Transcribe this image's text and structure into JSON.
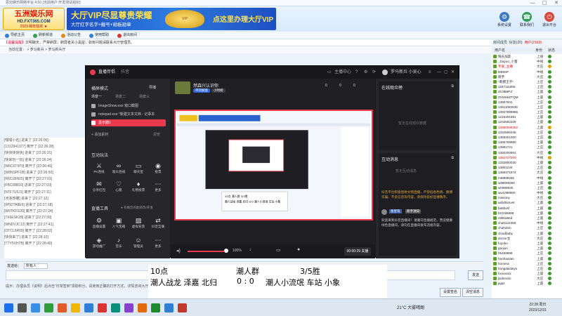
{
  "window": {
    "title": "思迈娱乐网络平台 4.50 [当前用户:开发测试组织]",
    "min": "—",
    "max": "▢",
    "close": "✕"
  },
  "banner": {
    "logo_main": "五洲娱乐网",
    "logo_url": "HD.FXT365.COM",
    "logo_sub": "2023 跨年狂欢 ★",
    "vip_title": "大厅VIP尽显尊贵荣耀",
    "vip_sub": "大厅红字名字+靓号+勋板勋章",
    "vip_crest": "VIP",
    "vip_cta": "点这里办理大厅VIP",
    "right_icons": [
      {
        "label": "系统设置",
        "color": "#3b78c5",
        "glyph": "⚙"
      },
      {
        "label": "联系我们",
        "color": "#2d9d58",
        "glyph": "☎"
      },
      {
        "label": "退出平台",
        "color": "#d9473d",
        "glyph": "⏻"
      }
    ]
  },
  "toolbar": [
    {
      "label": "导航主页",
      "color": "#2f7fd6"
    },
    {
      "label": "刷新频道",
      "color": "#30a04a"
    },
    {
      "label": "活动公告",
      "color": "#e08b16"
    },
    {
      "label": "使用帮助",
      "color": "#2f7fd6"
    },
    {
      "label": "退出房间",
      "color": "#d33"
    }
  ],
  "announce": {
    "tag": "【温馨提醒】",
    "text": "文明聊天，严禁刷屏，刷屏者关小黑屋，如有问题请联系大厅管理员。"
  },
  "roomnav": "当前位置：  >  罗马新兵  >  罗马新兵厅",
  "chat_messages": [
    "[嘿嘿小名] 进来了 [22:26:00]",
    "[1312941377] 离开了 [22:26:28]",
    "[快快快快快] 进来了 [22:26:31]",
    "[快来玩一玩] 进来了 [22:26:34]",
    "[W6C6T9T9] 离开了 [22:26:46]",
    "[W8NSPF1B] 进来了 [22:26:50]",
    "[R6C1BN15] 离开了 [22:27:01]",
    "[FBC08B16] 进来了 [22:27:03]",
    "[NTF7U5J1] 离开了 [22:27:11]",
    "[河洛传雕] 进来了 [22:27:12]",
    "[W5DTA8E6] 进来了 [22:27:18]",
    "[W9TKFG39] 离开了 [22:27:24]",
    "[7X6ESK28] 进来了 [22:27:30]",
    "[WNDVJC12] 离开了 [22:27:41]",
    "[OTCL5R09] 离开了 [22:28:02]",
    "[快快来了] 进来了 [22:28:10]",
    "[TTY5VH7B] 离开了 [22:28:40]"
  ],
  "chat_input": {
    "to_label": "发送给：",
    "target": "所有人",
    "send": "发送"
  },
  "hint": "提示：办理会员《说明》后点击“日常签到”领取积分，请使用正确的打开方式，详情咨询大厅客服。",
  "bottom_buttons": [
    "设置签名",
    "清空消息"
  ],
  "user_tabs": [
    "房间成员",
    "好友(20)",
    "用户(2163)"
  ],
  "user_head": [
    "用户名",
    "身份",
    "状态"
  ],
  "users": [
    {
      "name": "快乐加友",
      "role": "上线",
      "vip": false,
      "badge": "g"
    },
    {
      "name": "_Dayoo_小蜜",
      "role": "中线",
      "vip": false,
      "badge": "g"
    },
    {
      "name": "专爱_主播",
      "role": "大庄",
      "vip": true,
      "badge": "o"
    },
    {
      "name": "DB9SP",
      "role": "中线",
      "vip": false,
      "badge": "g"
    },
    {
      "name": "晓宇",
      "role": "大庄",
      "vip": false,
      "badge": "g"
    },
    {
      "name": "*刺猬王子*",
      "role": "上庄",
      "vip": false,
      "badge": "g"
    },
    {
      "name": "1167111655",
      "role": "上庄",
      "vip": false,
      "badge": "g"
    },
    {
      "name": "ZC9B8PZ",
      "role": "上座",
      "vip": false,
      "badge": "g"
    },
    {
      "name": "ZXMH8ZTQM",
      "role": "上座",
      "vip": false,
      "badge": "g"
    },
    {
      "name": "13857931",
      "role": "上庄",
      "vip": false,
      "badge": "g"
    },
    {
      "name": "13611083539",
      "role": "上庄",
      "vip": false,
      "badge": "g"
    },
    {
      "name": "13927999985",
      "role": "上庄",
      "vip": false,
      "badge": "g"
    },
    {
      "name": "1216191981",
      "role": "上座",
      "vip": false,
      "badge": "g"
    },
    {
      "name": "1233592329",
      "role": "上座",
      "vip": false,
      "badge": "g"
    },
    {
      "name": "13980098352",
      "role": "上座",
      "vip": true,
      "badge": "o"
    },
    {
      "name": "1334596345",
      "role": "上庄",
      "vip": false,
      "badge": "g"
    },
    {
      "name": "1368201000",
      "role": "上庄",
      "vip": false,
      "badge": "g"
    },
    {
      "name": "1365768980",
      "role": "上座",
      "vip": false,
      "badge": "g"
    },
    {
      "name": "13981721",
      "role": "上庄",
      "vip": false,
      "badge": "g"
    },
    {
      "name": "1360200901",
      "role": "大庄",
      "vip": false,
      "badge": "g"
    },
    {
      "name": "1392727000",
      "role": "中线",
      "vip": true,
      "badge": "o"
    },
    {
      "name": "1332800030",
      "role": "上座",
      "vip": false,
      "badge": "g"
    },
    {
      "name": "13801234",
      "role": "上庄",
      "vip": false,
      "badge": "g"
    },
    {
      "name": "1369371974",
      "role": "大庄",
      "vip": false,
      "badge": "g"
    },
    {
      "name": "mt8899282",
      "role": "中线",
      "vip": false,
      "badge": "g"
    },
    {
      "name": "w88099250",
      "role": "上座",
      "vip": false,
      "badge": "g"
    },
    {
      "name": "wh999820",
      "role": "上庄",
      "vip": false,
      "badge": "g"
    },
    {
      "name": "ww1098900",
      "role": "中线",
      "vip": false,
      "badge": "g"
    },
    {
      "name": "missony",
      "role": "大庄",
      "vip": false,
      "badge": "g"
    },
    {
      "name": "asbdtsmvet",
      "role": "上座",
      "vip": false,
      "badge": "g"
    },
    {
      "name": "ba5bvsf",
      "role": "上座",
      "vip": false,
      "badge": "g"
    },
    {
      "name": "bzzz66888",
      "role": "上座",
      "vip": false,
      "badge": "g"
    },
    {
      "name": "c980a9ed",
      "role": "上座",
      "vip": false,
      "badge": "g"
    },
    {
      "name": "chatt122466",
      "role": "中线",
      "vip": false,
      "badge": "g"
    },
    {
      "name": "chahdsm",
      "role": "上庄",
      "vip": false,
      "badge": "g"
    },
    {
      "name": "cloudbaby",
      "role": "上座",
      "vip": false,
      "badge": "g"
    },
    {
      "name": "doctor主",
      "role": "大庄",
      "vip": false,
      "badge": "g"
    },
    {
      "name": "fuyobo",
      "role": "上座",
      "vip": false,
      "badge": "g"
    },
    {
      "name": "gaojun",
      "role": "上座",
      "vip": false,
      "badge": "g"
    },
    {
      "name": "h5469999",
      "role": "上庄",
      "vip": false,
      "badge": "g"
    },
    {
      "name": "haohaotian",
      "role": "上座",
      "vip": false,
      "badge": "g"
    },
    {
      "name": "homexx",
      "role": "上庄",
      "vip": false,
      "badge": "g"
    },
    {
      "name": "hongdaidaiyo",
      "role": "上庄",
      "vip": false,
      "badge": "g"
    },
    {
      "name": "hxxxxxxx",
      "role": "上座",
      "vip": false,
      "badge": "g"
    },
    {
      "name": "jackmoto",
      "role": "大庄",
      "vip": false,
      "badge": "g"
    },
    {
      "name": "jajaz",
      "role": "上座",
      "vip": false,
      "badge": "g"
    }
  ],
  "stream": {
    "app_title": "直播伴侣",
    "app_sub": "抖音",
    "mode_label": "横屏模式",
    "import_label": "导播",
    "scene_tabs": [
      "场景一",
      "场景二",
      "场景三"
    ],
    "sources": [
      "ImageShow.exe 窗口截图",
      "notepad.exe *新建文本文档 - 记事本"
    ],
    "active_scene": "显示器1",
    "add_source": "+ 添加素材",
    "add_source_right": "源管",
    "interact_title": "互动玩法",
    "tools_row1": [
      "PK连线",
      "观众连线",
      "聊天室",
      "投票"
    ],
    "tools_row2": [
      "分享红包",
      "心愿",
      "礼物投票",
      "更多"
    ],
    "basic_title": "直播工具",
    "basic_hint": "● 有概念的能修改/开发",
    "tools_row3": [
      "直播设置",
      "人气宝箱",
      "虚拟背景",
      "抖音互联"
    ],
    "tools_row4": [
      "游戏推广",
      "音乐",
      "管理员",
      "更多"
    ],
    "streamer_name": "然森兴认识你",
    "streamer_btn1": "带货橱窗",
    "streamer_btn2": "小时榜",
    "stats": [
      "0",
      "0",
      "0"
    ],
    "top_right": [
      "主播中心",
      "罗马新兵 小吴心"
    ],
    "online_title": "在线观众榜",
    "online_empty": "暂无在线观众数据",
    "msg_title": "互动消息",
    "msg_empty": "暂无互动消息",
    "notice": "抖音平台积极倡导文明直播，严禁低俗色情、赌博诈骗、不良信息等内容，请保持良好直播秩序。",
    "notice_tags": [
      "星星等",
      "新手须知"
    ],
    "notice_body": "欢迎来到抖音直播间！请遵守直播规范，营造健康绿色直播间，请勿在直播间发布违规内容。",
    "volume": "100%",
    "live_time": "00:00:29",
    "live_label": "关播"
  },
  "scoreboard": {
    "time": "10点",
    "group": "潮人群",
    "result": "3/5胜",
    "team_a": "潮人战龙  泽嘉  北归",
    "score": "0 :  0",
    "team_b": "潮人小流氓  车站  小象"
  },
  "taskbar": {
    "weather": "21°C 大雾晴朗",
    "time": "22:28 周日",
    "date": "2023/12/31",
    "icons": [
      {
        "color": "#1f6feb"
      },
      {
        "color": "#555"
      },
      {
        "color": "#3a8ee6"
      },
      {
        "color": "#2e9d3a"
      },
      {
        "color": "#e05a2b"
      },
      {
        "color": "#f2b705"
      },
      {
        "color": "#2f7fd6"
      },
      {
        "color": "#d33"
      },
      {
        "color": "#0a8f7a"
      },
      {
        "color": "#8a3fd1"
      },
      {
        "color": "#e06b10"
      },
      {
        "color": "#1c8a2e"
      },
      {
        "color": "#2f7fd6"
      },
      {
        "color": "#c0392b"
      }
    ]
  }
}
